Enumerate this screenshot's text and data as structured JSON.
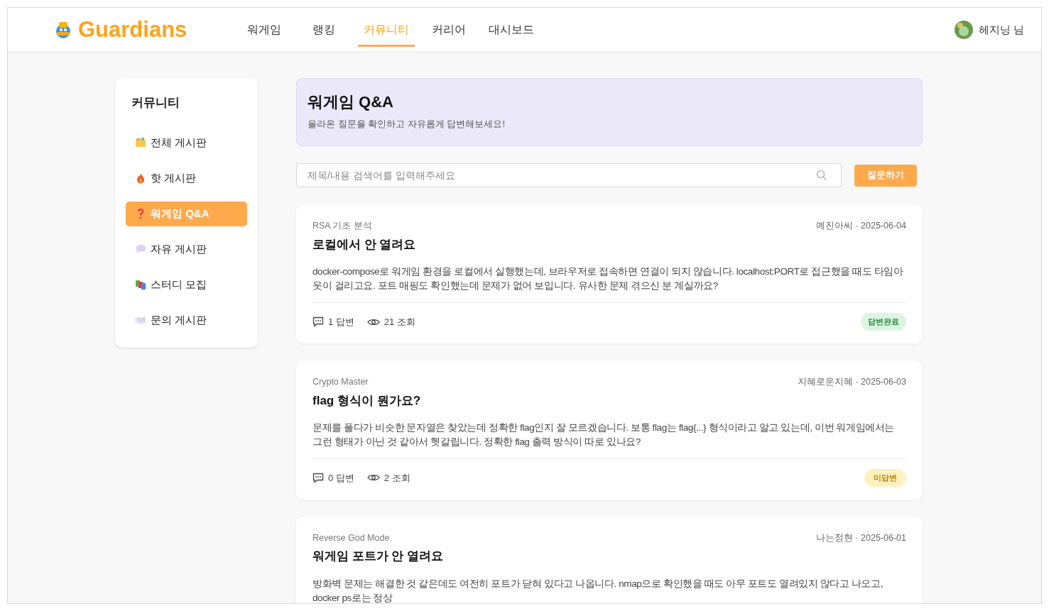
{
  "header": {
    "logo": "Guardians",
    "nav": [
      {
        "label": "워게임",
        "selected": false
      },
      {
        "label": "랭킹",
        "selected": false
      },
      {
        "label": "커뮤니티",
        "selected": true
      },
      {
        "label": "커리어",
        "selected": false
      },
      {
        "label": "대시보드",
        "selected": false
      }
    ],
    "user": "헤지닝 님"
  },
  "sidebar": {
    "title": "커뮤니티",
    "items": [
      {
        "kind": "folder",
        "label": "전체 게시판",
        "selected": false
      },
      {
        "kind": "fire",
        "label": "핫 게시판",
        "selected": false
      },
      {
        "kind": "question",
        "label": "워게임 Q&A",
        "selected": true
      },
      {
        "kind": "speech",
        "label": "자유 게시판",
        "selected": false
      },
      {
        "kind": "books",
        "label": "스터디 모집",
        "selected": false
      },
      {
        "kind": "mail",
        "label": "문의 게시판",
        "selected": false
      }
    ]
  },
  "banner": {
    "title": "워게임 Q&A",
    "subtitle": "올라온 질문을 확인하고 자유롭게 답변해보세요!"
  },
  "search": {
    "placeholder": "제목/내용 검색어를 입력해주세요",
    "button": "질문하기"
  },
  "posts": [
    {
      "category": "RSA 기초 분석",
      "meta": "예진아씨 · 2025-06-04",
      "title": "로컬에서 안 열려요",
      "body": "docker-compose로 워게임 환경을 로컬에서 실행했는데, 브라우저로 접속하면 연결이 되지 않습니다. localhost:PORT로 접근했을 때도 타임아웃이 걸리고요. 포트 매핑도 확인했는데 문제가 없어 보입니다. 유사한 문제 겪으신 분 계실까요?",
      "answers": "1 답변",
      "views": "21 조회",
      "status": "답변완료",
      "answered": true
    },
    {
      "category": "Crypto Master",
      "meta": "지혜로운지혜 · 2025-06-03",
      "title": "flag 형식이 뭔가요?",
      "body": "문제를 풀다가 비슷한 문자열은 찾았는데 정확한 flag인지 잘 모르겠습니다. 보통 flag는 flag{...} 형식이라고 알고 있는데, 이번 워게임에서는 그런 형태가 아닌 것 같아서 헷갈립니다. 정확한 flag 출력 방식이 따로 있나요?",
      "answers": "0 답변",
      "views": "2 조회",
      "status": "미답변",
      "answered": false
    },
    {
      "category": "Reverse God Mode",
      "meta": "나는정현 · 2025-06-01",
      "title": "워게임 포트가 안 열려요",
      "body": "방화벽 문제는 해결한 것 같은데도 여전히 포트가 닫혀 있다고 나옵니다. nmap으로 확인했을 때도 아무 포트도 열려있지 않다고 나오고, docker ps로는 정상"
    }
  ]
}
